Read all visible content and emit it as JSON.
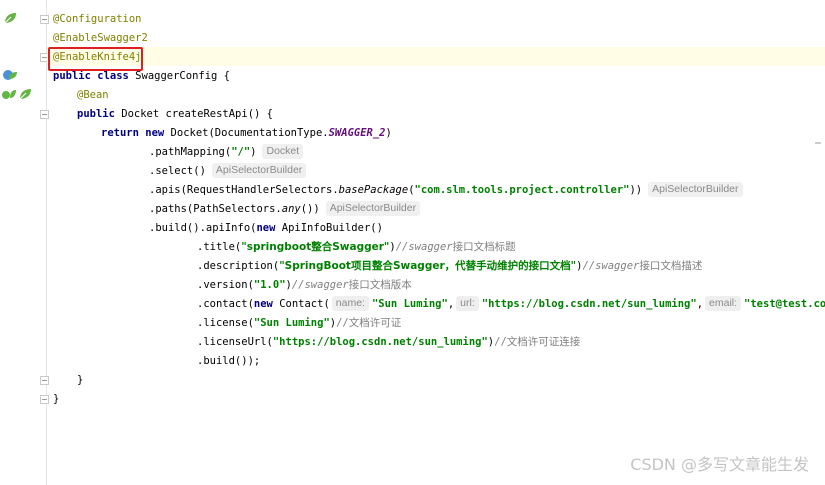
{
  "gutter": {
    "icons": [
      "leaf-icon",
      "bean-class-icon",
      "bean-method-icon"
    ]
  },
  "code": {
    "l1": "@Configuration",
    "l2": "@EnableSwagger2",
    "l3": "@EnableKnife4j",
    "l4_kw": "public class",
    "l4_rest": " SwaggerConfig {",
    "l5": "@Bean",
    "l6_kw": "public",
    "l6_rest": " Docket createRestApi() {",
    "l7_kw1": "return",
    "l7_kw2": "new",
    "l7_a": " Docket(DocumentationType.",
    "l7_field": "SWAGGER_2",
    "l7_b": ")",
    "l8_a": ".pathMapping(",
    "l8_str": "\"/\"",
    "l8_b": ")",
    "l8_hint": "Docket",
    "l9_a": ".select()",
    "l9_hint": "ApiSelectorBuilder",
    "l10_a": ".apis(RequestHandlerSelectors.",
    "l10_it": "basePackage",
    "l10_b": "(",
    "l10_str": "\"com.slm.tools.project.controller\"",
    "l10_c": "))",
    "l10_hint": "ApiSelectorBuilder",
    "l11_a": ".paths(PathSelectors.",
    "l11_it": "any",
    "l11_b": "())",
    "l11_hint": "ApiSelectorBuilder",
    "l12_a": ".build().apiInfo(",
    "l12_kw": "new",
    "l12_b": " ApiInfoBuilder()",
    "l13_a": ".title(",
    "l13_str": "\"springboot整合Swagger\"",
    "l13_b": ")",
    "l13_cmt": "//swagger",
    "l13_cmt_cn": "接口文档标题",
    "l14_a": ".description(",
    "l14_str": "\"SpringBoot项目整合Swagger，代替手动维护的接口文档\"",
    "l14_b": ")",
    "l14_cmt": "//swagger",
    "l14_cmt_cn": "接口文档描述",
    "l15_a": ".version(",
    "l15_str": "\"1.0\"",
    "l15_b": ")",
    "l15_cmt": "//swagger",
    "l15_cmt_cn": "接口文档版本",
    "l16_a": ".contact(",
    "l16_kw": "new",
    "l16_b": " Contact(",
    "l16_hint1": "name:",
    "l16_str1": "\"Sun Luming\"",
    "l16_comma1": ",",
    "l16_hint2": "url:",
    "l16_str2": "\"https://blog.csdn.net/sun_luming\"",
    "l16_comma2": ",",
    "l16_hint3": "email:",
    "l16_str3": "\"test@test.com\"",
    "l17_a": ".license(",
    "l17_str": "\"Sun Luming\"",
    "l17_b": ")",
    "l17_cmt": "//",
    "l17_cmt_cn": "文档许可证",
    "l18_a": ".licenseUrl(",
    "l18_str": "\"https://blog.csdn.net/sun_luming\"",
    "l18_b": ")",
    "l18_cmt": "//",
    "l18_cmt_cn": "文档许可证连接",
    "l19_a": ".build());",
    "l20": "}",
    "l21": "}"
  },
  "watermark": "CSDN @多写文章能生发",
  "colors": {
    "annotation": "#808000",
    "keyword": "#000080",
    "string": "#008000",
    "comment": "#808080",
    "field": "#660e7a",
    "highlight_box": "#e02020"
  }
}
